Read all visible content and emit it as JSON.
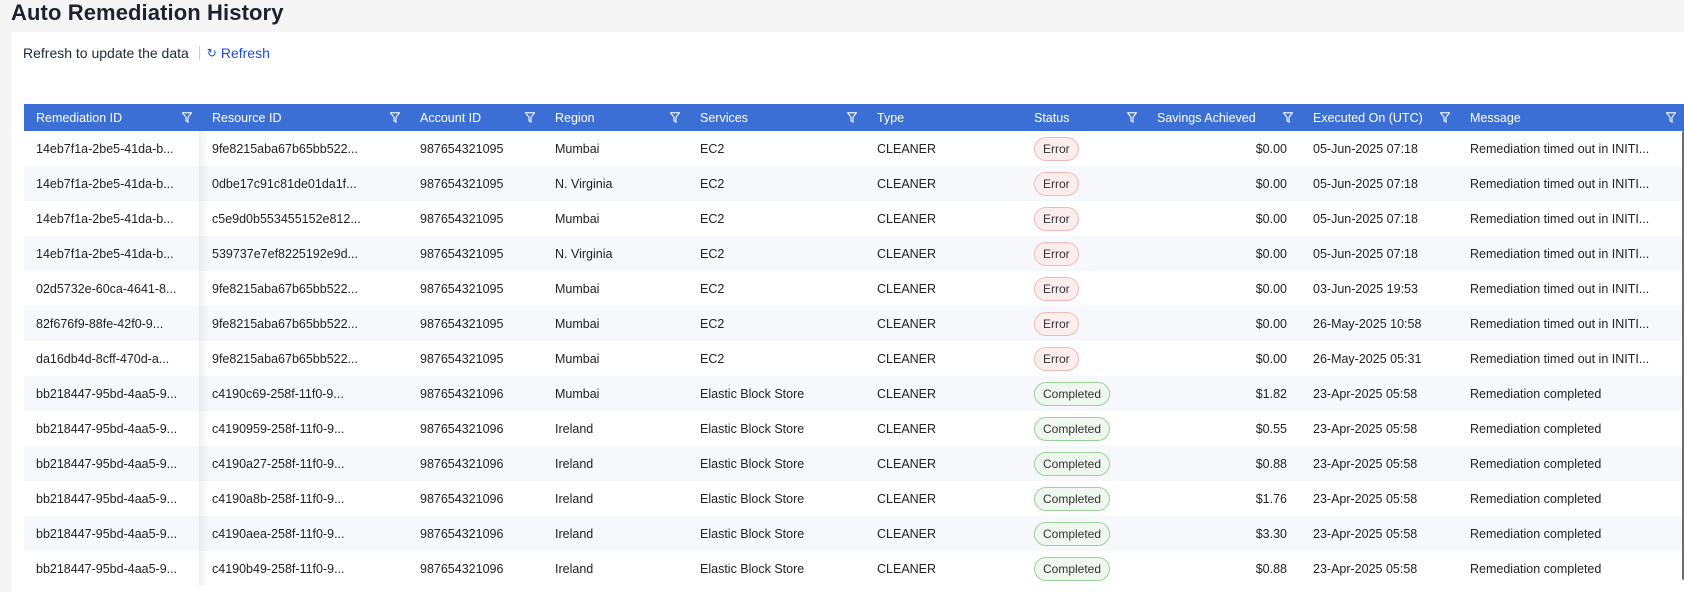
{
  "page": {
    "title": "Auto Remediation History"
  },
  "toolbar": {
    "refresh_hint": "Refresh to update the data",
    "refresh_label": "Refresh"
  },
  "colors": {
    "header_bg": "#3b6fd6",
    "link": "#1d4ed8",
    "error_badge": "#fdeeee",
    "completed_badge": "#eef8ee"
  },
  "icons": {
    "refresh": "refresh-icon",
    "filter": "filter-icon"
  },
  "table": {
    "columns": [
      "Remediation ID",
      "Resource ID",
      "Account ID",
      "Region",
      "Services",
      "Type",
      "Status",
      "Savings Achieved",
      "Executed On (UTC)",
      "Message"
    ],
    "rows": [
      [
        "14eb7f1a-2be5-41da-b...",
        "9fe8215aba67b65bb522...",
        "987654321095",
        "Mumbai",
        "EC2",
        "CLEANER",
        "Error",
        "$0.00",
        "05-Jun-2025 07:18",
        "Remediation timed out in INITI..."
      ],
      [
        "14eb7f1a-2be5-41da-b...",
        "0dbe17c91c81de01da1f...",
        "987654321095",
        "N. Virginia",
        "EC2",
        "CLEANER",
        "Error",
        "$0.00",
        "05-Jun-2025 07:18",
        "Remediation timed out in INITI..."
      ],
      [
        "14eb7f1a-2be5-41da-b...",
        "c5e9d0b553455152e812...",
        "987654321095",
        "Mumbai",
        "EC2",
        "CLEANER",
        "Error",
        "$0.00",
        "05-Jun-2025 07:18",
        "Remediation timed out in INITI..."
      ],
      [
        "14eb7f1a-2be5-41da-b...",
        "539737e7ef8225192e9d...",
        "987654321095",
        "N. Virginia",
        "EC2",
        "CLEANER",
        "Error",
        "$0.00",
        "05-Jun-2025 07:18",
        "Remediation timed out in INITI..."
      ],
      [
        "02d5732e-60ca-4641-8...",
        "9fe8215aba67b65bb522...",
        "987654321095",
        "Mumbai",
        "EC2",
        "CLEANER",
        "Error",
        "$0.00",
        "03-Jun-2025 19:53",
        "Remediation timed out in INITI..."
      ],
      [
        "82f676f9-88fe-42f0-9...",
        "9fe8215aba67b65bb522...",
        "987654321095",
        "Mumbai",
        "EC2",
        "CLEANER",
        "Error",
        "$0.00",
        "26-May-2025 10:58",
        "Remediation timed out in INITI..."
      ],
      [
        "da16db4d-8cff-470d-a...",
        "9fe8215aba67b65bb522...",
        "987654321095",
        "Mumbai",
        "EC2",
        "CLEANER",
        "Error",
        "$0.00",
        "26-May-2025 05:31",
        "Remediation timed out in INITI..."
      ],
      [
        "bb218447-95bd-4aa5-9...",
        "c4190c69-258f-11f0-9...",
        "987654321096",
        "Mumbai",
        "Elastic Block Store",
        "CLEANER",
        "Completed",
        "$1.82",
        "23-Apr-2025 05:58",
        "Remediation completed"
      ],
      [
        "bb218447-95bd-4aa5-9...",
        "c4190959-258f-11f0-9...",
        "987654321096",
        "Ireland",
        "Elastic Block Store",
        "CLEANER",
        "Completed",
        "$0.55",
        "23-Apr-2025 05:58",
        "Remediation completed"
      ],
      [
        "bb218447-95bd-4aa5-9...",
        "c4190a27-258f-11f0-9...",
        "987654321096",
        "Ireland",
        "Elastic Block Store",
        "CLEANER",
        "Completed",
        "$0.88",
        "23-Apr-2025 05:58",
        "Remediation completed"
      ],
      [
        "bb218447-95bd-4aa5-9...",
        "c4190a8b-258f-11f0-9...",
        "987654321096",
        "Ireland",
        "Elastic Block Store",
        "CLEANER",
        "Completed",
        "$1.76",
        "23-Apr-2025 05:58",
        "Remediation completed"
      ],
      [
        "bb218447-95bd-4aa5-9...",
        "c4190aea-258f-11f0-9...",
        "987654321096",
        "Ireland",
        "Elastic Block Store",
        "CLEANER",
        "Completed",
        "$3.30",
        "23-Apr-2025 05:58",
        "Remediation completed"
      ],
      [
        "bb218447-95bd-4aa5-9...",
        "c4190b49-258f-11f0-9...",
        "987654321096",
        "Ireland",
        "Elastic Block Store",
        "CLEANER",
        "Completed",
        "$0.88",
        "23-Apr-2025 05:58",
        "Remediation completed"
      ]
    ]
  }
}
